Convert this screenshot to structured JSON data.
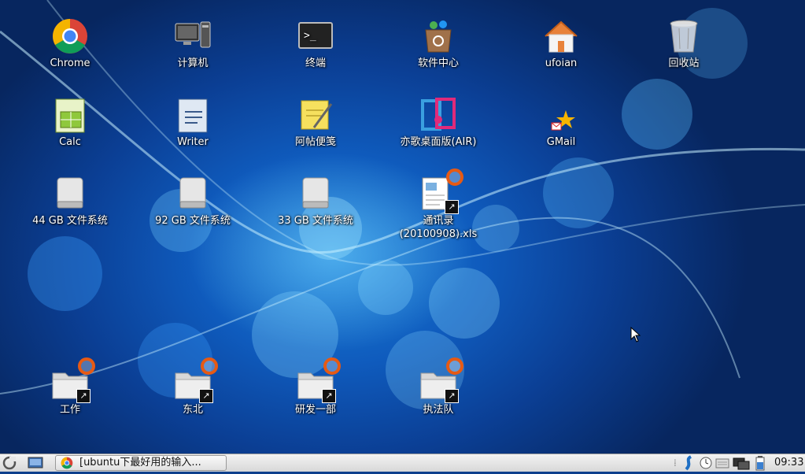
{
  "desktop": {
    "icons": [
      {
        "label": "Chrome",
        "icon": "chrome-icon"
      },
      {
        "label": "计算机",
        "icon": "computer-icon"
      },
      {
        "label": "终端",
        "icon": "terminal-icon"
      },
      {
        "label": "软件中心",
        "icon": "software-center-icon"
      },
      {
        "label": "ufoian",
        "icon": "home-folder-icon"
      },
      {
        "label": "回收站",
        "icon": "trash-icon"
      },
      {
        "label": "Calc",
        "icon": "calc-icon"
      },
      {
        "label": "Writer",
        "icon": "writer-icon"
      },
      {
        "label": "阿帖便笺",
        "icon": "sticky-note-icon"
      },
      {
        "label": "亦歌桌面版(AIR)",
        "icon": "music-player-icon"
      },
      {
        "label": "GMail",
        "icon": "gmail-icon"
      },
      {
        "label": "44 GB 文件系统",
        "icon": "drive-icon"
      },
      {
        "label": "92 GB 文件系统",
        "icon": "drive-icon"
      },
      {
        "label": "33 GB 文件系统",
        "icon": "drive-icon"
      },
      {
        "label": "通讯录(20100908).xls",
        "icon": "spreadsheet-shortcut-icon"
      },
      {
        "label": "工作",
        "icon": "folder-shortcut-icon"
      },
      {
        "label": "东北",
        "icon": "folder-shortcut-icon"
      },
      {
        "label": "研发一部",
        "icon": "folder-shortcut-icon"
      },
      {
        "label": "执法队",
        "icon": "folder-shortcut-icon"
      }
    ]
  },
  "taskbar": {
    "window_title": "[ubuntu下最好用的输入...",
    "clock": "09:33",
    "tray_icons": [
      "network-icon",
      "clock-icon",
      "keyboard-icon",
      "display-icon",
      "battery-icon"
    ]
  },
  "colors": {
    "desktop_bg": "#0f5bbd",
    "taskbar_bg": "#e6e6e6",
    "label_text": "#ffffff"
  }
}
